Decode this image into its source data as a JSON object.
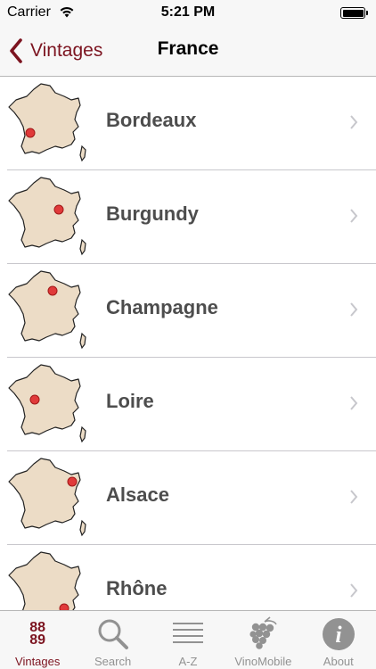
{
  "status_bar": {
    "carrier": "Carrier",
    "time": "5:21 PM"
  },
  "nav": {
    "back_label": "Vintages",
    "title": "France"
  },
  "regions": [
    {
      "label": "Bordeaux",
      "icon": "france-map-icon"
    },
    {
      "label": "Burgundy",
      "icon": "france-map-icon"
    },
    {
      "label": "Champagne",
      "icon": "france-map-icon"
    },
    {
      "label": "Loire",
      "icon": "france-map-icon"
    },
    {
      "label": "Alsace",
      "icon": "france-map-icon"
    },
    {
      "label": "Rhône",
      "icon": "france-map-icon"
    }
  ],
  "tabs": [
    {
      "label": "Vintages",
      "icon": "88-89",
      "active": true
    },
    {
      "label": "Search",
      "icon": "magnifier-icon",
      "active": false
    },
    {
      "label": "A-Z",
      "icon": "list-lines-icon",
      "active": false
    },
    {
      "label": "VinoMobile",
      "icon": "grapes-icon",
      "active": false
    },
    {
      "label": "About",
      "icon": "info-icon",
      "active": false
    }
  ],
  "colors": {
    "accent": "#7c1420",
    "map_fill": "#ecdcc6",
    "marker": "#e03a3a",
    "label_gray": "#4d4d4d",
    "tab_inactive": "#929292"
  }
}
